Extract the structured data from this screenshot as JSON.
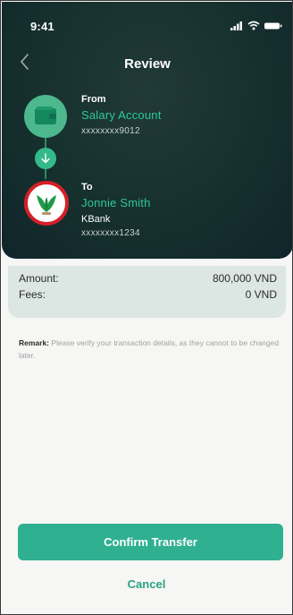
{
  "status_bar": {
    "time": "9:41"
  },
  "header": {
    "title": "Review"
  },
  "from": {
    "label": "From",
    "account_name": "Salary Account",
    "account_number": "xxxxxxxx9012"
  },
  "to": {
    "label": "To",
    "name": "Jonnie Smith",
    "bank": "KBank",
    "account_number": "xxxxxxxx1234"
  },
  "amounts": {
    "amount_label": "Amount:",
    "amount_value": "800,000 VND",
    "fees_label": "Fees:",
    "fees_value": "0 VND"
  },
  "remark": {
    "label": "Remark:",
    "text": "Please verify your transaction details, as they cannot to be changed later."
  },
  "actions": {
    "confirm_label": "Confirm Transfer",
    "cancel_label": "Cancel"
  },
  "colors": {
    "accent": "#2fb091",
    "header_bg": "#16302e",
    "bank_logo_red": "#d32027",
    "bank_logo_green": "#1e9a4a"
  },
  "icons": [
    "signal-icon",
    "wifi-icon",
    "battery-icon",
    "back-chevron-icon",
    "wallet-icon",
    "arrow-down-icon",
    "kbank-logo-icon"
  ]
}
